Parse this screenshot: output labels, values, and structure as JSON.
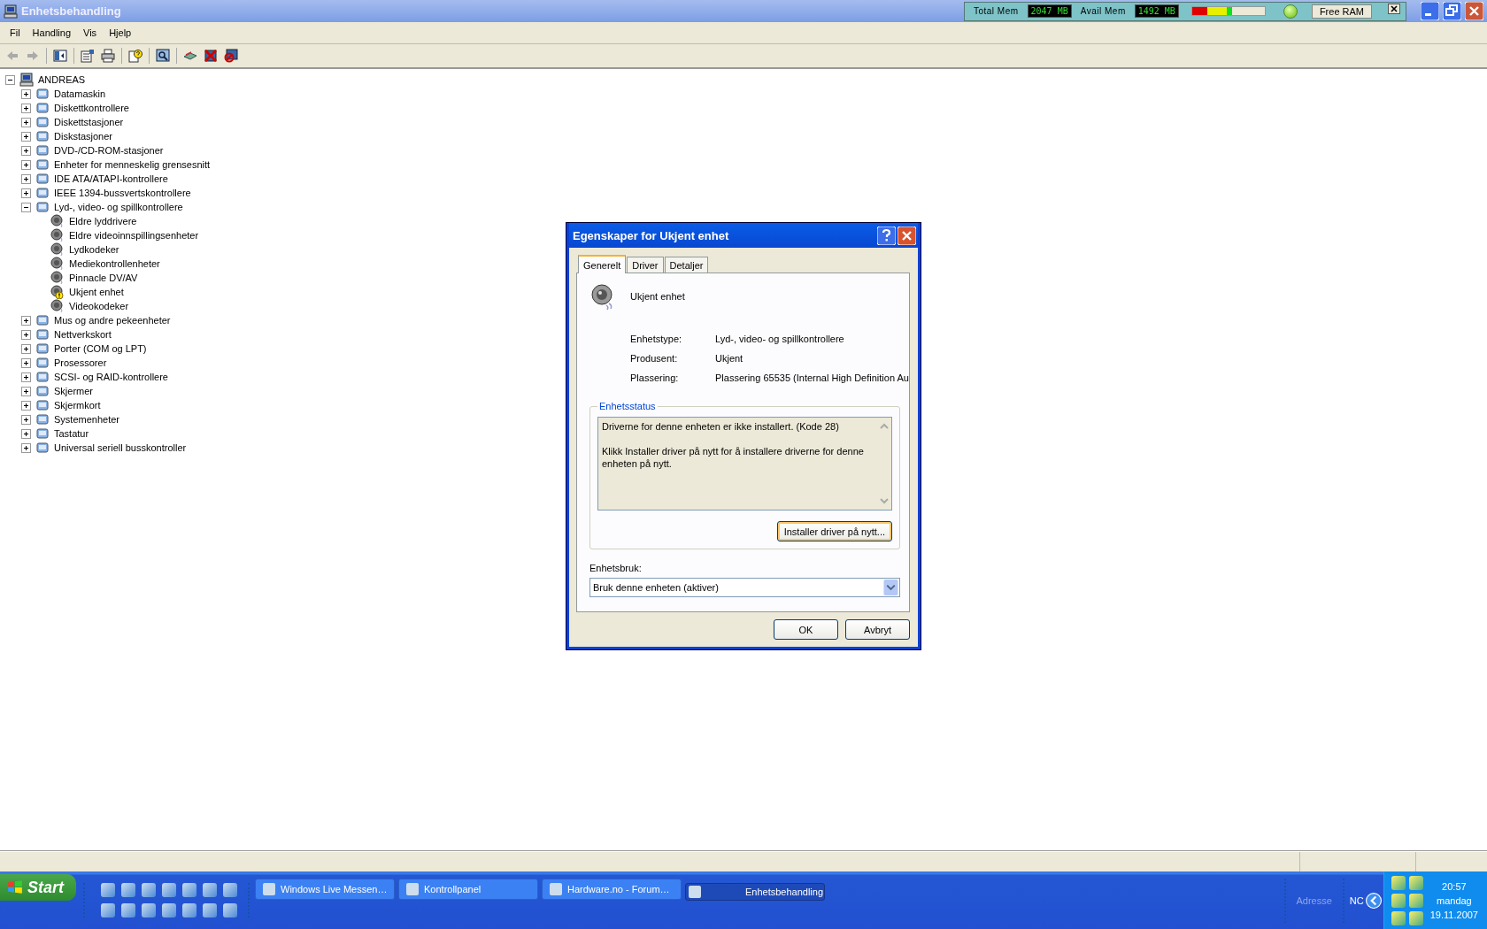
{
  "window": {
    "title": "Enhetsbehandling"
  },
  "mem_monitor": {
    "total_label": "Total Mem",
    "total_value": "2047 MB",
    "avail_label": "Avail Mem",
    "avail_value": "1492 MB",
    "meter": {
      "level": 0.55
    },
    "free_button": "Free RAM"
  },
  "menu": [
    "Fil",
    "Handling",
    "Vis",
    "Hjelp"
  ],
  "tree": {
    "root": {
      "label": "ANDREAS",
      "expanded": true
    },
    "items": [
      {
        "label": "Datamaskin",
        "expanded": false
      },
      {
        "label": "Diskettkontrollere",
        "expanded": false
      },
      {
        "label": "Diskettstasjoner",
        "expanded": false
      },
      {
        "label": "Diskstasjoner",
        "expanded": false
      },
      {
        "label": "DVD-/CD-ROM-stasjoner",
        "expanded": false
      },
      {
        "label": "Enheter for menneskelig grensesnitt",
        "expanded": false
      },
      {
        "label": "IDE ATA/ATAPI-kontrollere",
        "expanded": false
      },
      {
        "label": "IEEE 1394-bussvertskontrollere",
        "expanded": false
      },
      {
        "label": "Lyd-, video- og spillkontrollere",
        "expanded": true,
        "children": [
          {
            "label": "Eldre lyddrivere",
            "warning": false
          },
          {
            "label": "Eldre videoinnspillingsenheter",
            "warning": false
          },
          {
            "label": "Lydkodeker",
            "warning": false
          },
          {
            "label": "Mediekontrollenheter",
            "warning": false
          },
          {
            "label": "Pinnacle DV/AV",
            "warning": false
          },
          {
            "label": "Ukjent enhet",
            "warning": true
          },
          {
            "label": "Videokodeker",
            "warning": false
          }
        ]
      },
      {
        "label": "Mus og andre pekeenheter",
        "expanded": false
      },
      {
        "label": "Nettverkskort",
        "expanded": false
      },
      {
        "label": "Porter (COM og LPT)",
        "expanded": false
      },
      {
        "label": "Prosessorer",
        "expanded": false
      },
      {
        "label": "SCSI- og RAID-kontrollere",
        "expanded": false
      },
      {
        "label": "Skjermer",
        "expanded": false
      },
      {
        "label": "Skjermkort",
        "expanded": false
      },
      {
        "label": "Systemenheter",
        "expanded": false
      },
      {
        "label": "Tastatur",
        "expanded": false
      },
      {
        "label": "Universal seriell busskontroller",
        "expanded": false
      }
    ]
  },
  "dialog": {
    "title": "Egenskaper for Ukjent enhet",
    "tabs": [
      {
        "label": "Generelt",
        "selected": true
      },
      {
        "label": "Driver",
        "selected": false
      },
      {
        "label": "Detaljer",
        "selected": false
      }
    ],
    "device_name": "Ukjent enhet",
    "properties": [
      {
        "label": "Enhetstype:",
        "value": "Lyd-, video- og spillkontrollere"
      },
      {
        "label": "Produsent:",
        "value": "Ukjent"
      },
      {
        "label": "Plassering:",
        "value": "Plassering 65535 (Internal High Definition Au"
      }
    ],
    "status_group": "Enhetsstatus",
    "status_text": "Driverne for denne enheten er ikke installert. (Kode 28)\n\nKlikk Installer driver på nytt for å installere driverne for denne enheten på nytt.",
    "reinstall_button": "Installer driver på nytt...",
    "usage_label": "Enhetsbruk:",
    "usage_value": "Bruk denne enheten (aktiver)",
    "buttons": [
      "OK",
      "Avbryt"
    ]
  },
  "taskbar": {
    "start": "Start",
    "tasks": [
      {
        "label": "Windows Live Messen…",
        "selected": false
      },
      {
        "label": "Kontrollpanel",
        "selected": false
      },
      {
        "label": "Hardware.no - Forum…",
        "selected": false
      },
      {
        "label": "Enhetsbehandling",
        "selected": true
      }
    ],
    "address_label": "Adresse",
    "nc": "NC",
    "time": "20:57",
    "day": "mandag",
    "date": "19.11.2007"
  }
}
